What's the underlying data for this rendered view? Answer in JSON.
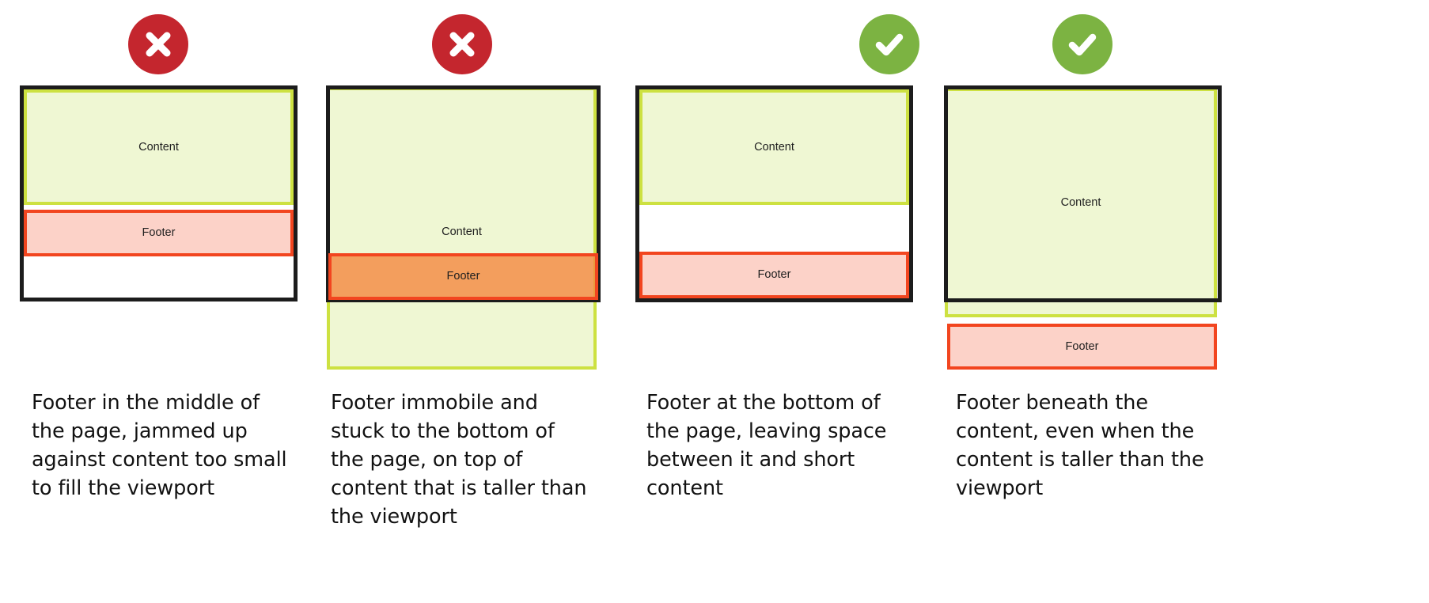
{
  "figure": {
    "type": "layout-comparison-diagram",
    "box_labels": {
      "content": "Content",
      "footer": "Footer"
    },
    "colors": {
      "content_border": "#cde141",
      "content_fill": "#eff7d3",
      "footer_border": "#f2451f",
      "footer_fill": "#fcd2c8",
      "footer_overlay_fill": "#f4853c",
      "viewport_border": "#1c1c1c",
      "bad_icon": "#c4262e",
      "good_icon": "#7cb342",
      "background": "#ffffff",
      "text": "#121212"
    }
  },
  "panels": [
    {
      "id": "panel-1",
      "status": "bad",
      "status_icon": "cross-circle-icon",
      "content_label": "Content",
      "footer_label": "Footer",
      "caption": "Footer in the middle of the page, jammed up against content too small to fill the viewport"
    },
    {
      "id": "panel-2",
      "status": "bad",
      "status_icon": "cross-circle-icon",
      "content_label": "Content",
      "footer_label": "Footer",
      "caption": "Footer immobile and stuck to the bottom of the page, on top of content that is taller than the viewport"
    },
    {
      "id": "panel-3",
      "status": "good",
      "status_icon": "check-circle-icon",
      "content_label": "Content",
      "footer_label": "Footer",
      "caption": "Footer at the bottom of the page, leaving space between it and short content"
    },
    {
      "id": "panel-4",
      "status": "good",
      "status_icon": "check-circle-icon",
      "content_label": "Content",
      "footer_label": "Footer",
      "caption": "Footer beneath the content, even when the content is taller than the viewport"
    }
  ]
}
